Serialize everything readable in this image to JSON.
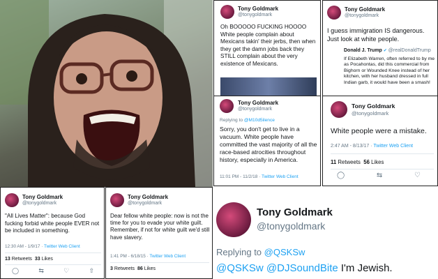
{
  "tweets": [
    {
      "name": "Tony Goldmark",
      "handle": "@tonygoldmark",
      "text": "Oh BOOOOO FUCKING HOOOO\nWhite people complain about Mexicans takin' their jerbs, then when they get the damn jobs back they STILL complain about the very existence of Mexicans."
    },
    {
      "name": "Tony Goldmark",
      "handle": "@tonygoldmark",
      "text": "I guess immigration IS dangerous. Just look at white people.",
      "quoted": {
        "name": "Donald J. Trump",
        "handle": "@realDonaldTrump",
        "text": "If Elizabeth Warren, often referred to by me as Pocahontas, did this commercial from Bighorn or Wounded Knee instead of her kitchen, with her husband dressed in full Indian garb, it would have been a smash!"
      }
    },
    {
      "name": "Tony Goldmark",
      "handle": "@tonygoldmark",
      "reply_prefix": "Replying to",
      "reply_to": "@M10d5ilence",
      "text": "Sorry, you don't get to live in a vacuum. White people have committed the vast majority of all the race-based atrocities throughout history, especially in America.",
      "time": "11:01 PM - 11/2/18",
      "client": "Twitter Web Client"
    },
    {
      "name": "Tony Goldmark",
      "handle": "@tonygoldmark",
      "text": "White people were a mistake.",
      "time": "2:47 AM - 8/13/17",
      "client": "Twitter Web Client",
      "retweets": "11",
      "retweets_label": "Retweets",
      "likes": "56",
      "likes_label": "Likes"
    },
    {
      "name": "Tony Goldmark",
      "handle": "@tonygoldmark",
      "text": "\"All Lives Matter\": because God fucking forbid white people EVER not be included in something.",
      "time": "12:30 AM - 1/9/17",
      "client": "Twitter Web Client",
      "retweets": "13",
      "retweets_label": "Retweets",
      "likes": "33",
      "likes_label": "Likes"
    },
    {
      "name": "Tony Goldmark",
      "handle": "@tonygoldmark",
      "text": "Dear fellow white people: now is not the time for you to evade your white guilt. Remember, if not for white guilt we'd still have slavery.",
      "time": "1:41 PM - 6/18/15",
      "client": "Twitter Web Client",
      "retweets": "3",
      "retweets_label": "Retweets",
      "likes": "86",
      "likes_label": "Likes"
    },
    {
      "name": "Tony Goldmark",
      "handle": "@tonygoldmark",
      "reply_prefix": "Replying to",
      "reply_to": "@QSKSw",
      "mention1": "@QSKSw",
      "mention2": "@DJSoundBite",
      "text": "I'm Jewish."
    }
  ],
  "icons": [
    "reply-icon",
    "retweet-icon",
    "like-icon",
    "share-icon"
  ],
  "colors": {
    "link": "#1da1f2",
    "muted": "#657786",
    "text": "#14171a"
  }
}
